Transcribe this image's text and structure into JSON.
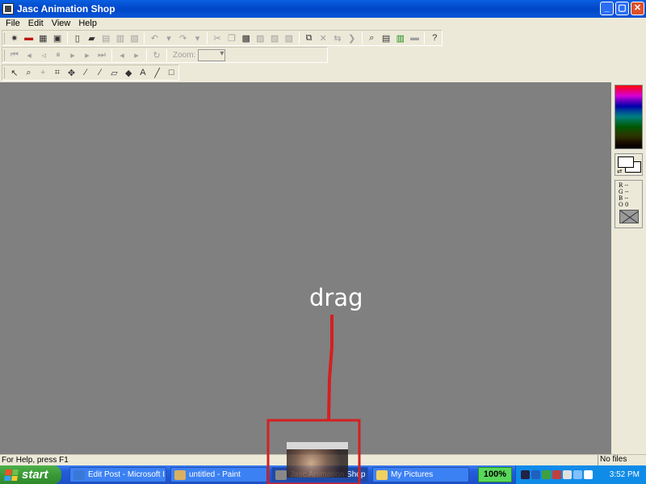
{
  "window": {
    "title": "Jasc Animation Shop",
    "minimize": "_",
    "maximize": "▢",
    "close": "✕"
  },
  "menu": [
    "File",
    "Edit",
    "View",
    "Help"
  ],
  "toolbar": {
    "zoom_label": "Zoom:"
  },
  "annotation": {
    "text": "drag",
    "color": "#d42020"
  },
  "status": {
    "help": "For Help, press F1",
    "files": "No files open"
  },
  "taskbar": {
    "start": "start",
    "tasks": [
      "Edit Post - Microsoft I...",
      "untitled - Paint",
      "Jasc Animation Shop",
      "My Pictures"
    ],
    "zoom_percent": "100%",
    "clock": "3:52 PM"
  },
  "colors": {
    "titlebar": "#0047c8",
    "workspace": "#808080",
    "taskbar": "#245edb",
    "start": "#3a9a36"
  }
}
